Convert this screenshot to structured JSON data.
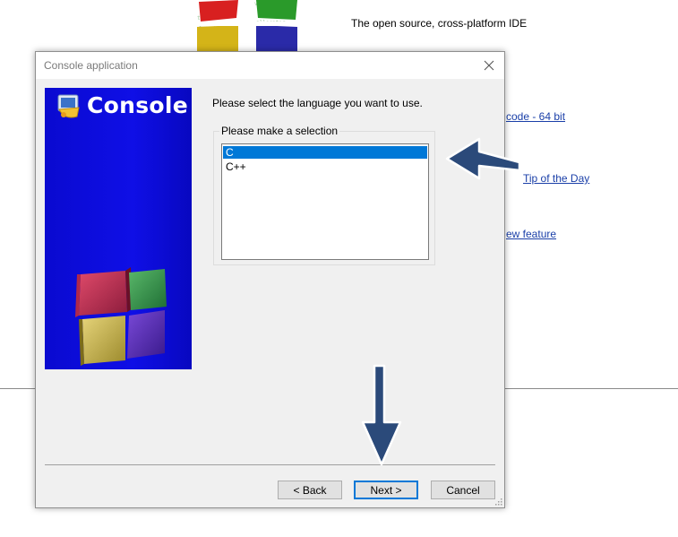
{
  "background": {
    "tagline": "The open source, cross-platform IDE",
    "links": [
      {
        "label": "code - 64 bit"
      },
      {
        "label": "Tip of the Day"
      },
      {
        "label": "ew feature "
      }
    ]
  },
  "dialog": {
    "title": "Console application",
    "side_title": "Console",
    "prompt": "Please select the language you want to use.",
    "group_label": "Please make a selection",
    "languages": [
      {
        "label": "C",
        "selected": true
      },
      {
        "label": "C++",
        "selected": false
      }
    ],
    "buttons": {
      "back": "< Back",
      "next": "Next >",
      "cancel": "Cancel"
    },
    "colors": {
      "selection": "#0078d7",
      "side_panel": "#0f0fe6",
      "arrow": "#2b4a7a"
    }
  }
}
